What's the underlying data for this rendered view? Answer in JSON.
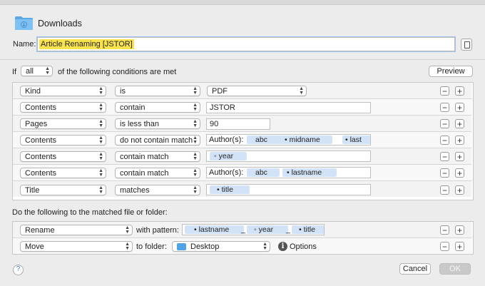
{
  "header": {
    "title": "Downloads",
    "name_label": "Name:",
    "name_value": "Article Renaming [JSTOR]"
  },
  "conditions": {
    "prefix": "If",
    "match_mode": "all",
    "suffix": "of the following conditions are met",
    "preview_label": "Preview",
    "rows": [
      {
        "attribute": "Kind",
        "operator": "is",
        "value_type": "popup",
        "value": "PDF"
      },
      {
        "attribute": "Contents",
        "operator": "contain",
        "value_type": "text",
        "value": "JSTOR"
      },
      {
        "attribute": "Pages",
        "operator": "is less than",
        "value_type": "text",
        "value": "90"
      },
      {
        "attribute": "Contents",
        "operator": "do not contain match",
        "value_type": "tokens",
        "prefix": "Author(s):",
        "tokens": [
          "abc",
          "midname",
          "last"
        ]
      },
      {
        "attribute": "Contents",
        "operator": "contain match",
        "value_type": "tokens",
        "prefix": "",
        "tokens": [
          "year"
        ]
      },
      {
        "attribute": "Contents",
        "operator": "contain match",
        "value_type": "tokens",
        "prefix": "Author(s):",
        "tokens": [
          "abc",
          "lastname"
        ]
      },
      {
        "attribute": "Title",
        "operator": "matches",
        "value_type": "tokens",
        "prefix": "",
        "tokens": [
          "title"
        ]
      }
    ]
  },
  "actions": {
    "heading": "Do the following to the matched file or folder:",
    "rows": [
      {
        "action": "Rename",
        "connector": "with pattern:",
        "tokens": [
          "lastname",
          "year",
          "title"
        ],
        "separators": [
          "_",
          "_"
        ]
      },
      {
        "action": "Move",
        "connector": "to folder:",
        "folder": "Desktop",
        "options_label": "Options"
      }
    ]
  },
  "footer": {
    "help_label": "?",
    "cancel_label": "Cancel",
    "ok_label": "OK"
  }
}
